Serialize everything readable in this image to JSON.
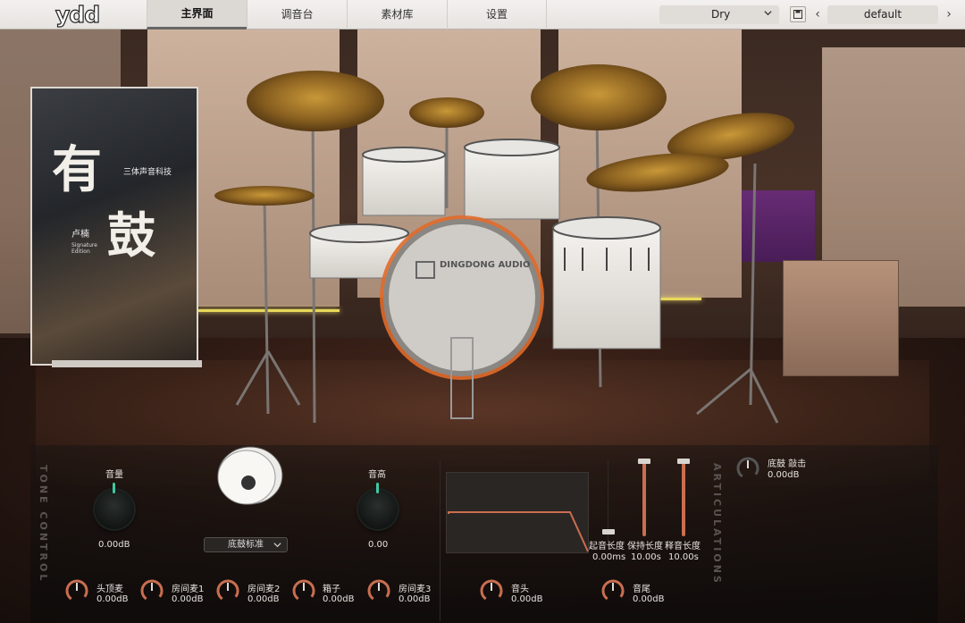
{
  "app": {
    "logo": "ydd"
  },
  "tabs": [
    {
      "label": "主界面"
    },
    {
      "label": "调音台"
    },
    {
      "label": "素材库"
    },
    {
      "label": "设置"
    }
  ],
  "mix_select": {
    "value": "Dry"
  },
  "preset": {
    "name": "default"
  },
  "banner": {
    "title_1": "有",
    "title_2": "鼓",
    "tagline": "三体声音科技",
    "artist": "卢楠",
    "edition": "Signature Edition"
  },
  "kick_drum_label": "DINGDONG AUDIO",
  "tone_control": {
    "section_label": "TONE CONTROL",
    "volume": {
      "label": "音量",
      "value": "0.00dB"
    },
    "pitch": {
      "label": "音高",
      "value": "0.00"
    },
    "kick_type": {
      "value": "底鼓标准"
    },
    "mics": [
      {
        "label": "头顶麦",
        "value": "0.00dB"
      },
      {
        "label": "房间麦1",
        "value": "0.00dB"
      },
      {
        "label": "房间麦2",
        "value": "0.00dB"
      },
      {
        "label": "箱子",
        "value": "0.00dB"
      },
      {
        "label": "房间麦3",
        "value": "0.00dB"
      }
    ]
  },
  "envelope": {
    "attack": {
      "label": "起音长度",
      "value": "0.00ms"
    },
    "hold": {
      "label": "保持长度",
      "value": "10.00s"
    },
    "release": {
      "label": "释音长度",
      "value": "10.00s"
    },
    "head": {
      "label": "音头",
      "value": "0.00dB"
    },
    "tail": {
      "label": "音尾",
      "value": "0.00dB"
    }
  },
  "articulations": {
    "section_label": "ARTICULATIONS",
    "item": {
      "label": "底鼓 敲击",
      "value": "0.00dB"
    }
  },
  "colors": {
    "accent": "#3fc8a0",
    "knob_ring": "#c96e50",
    "selection_outline": "#e06a2a"
  }
}
